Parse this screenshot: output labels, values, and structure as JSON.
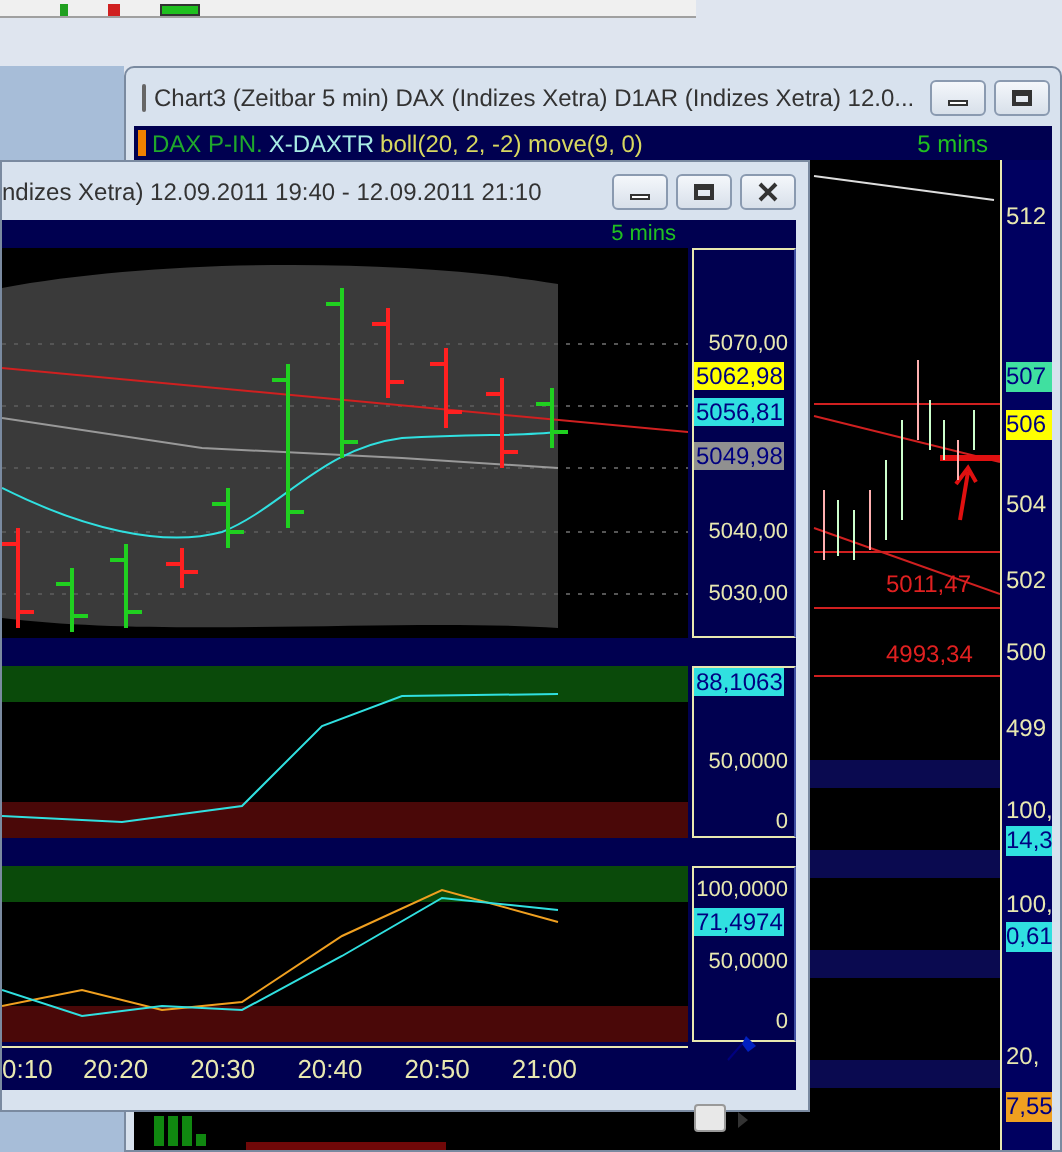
{
  "back_window": {
    "title": "Chart3 (Zeitbar 5 min)  DAX (Indizes Xetra) D1AR (Indizes Xetra) 12.0...",
    "legend": [
      "DAX P-IN.",
      "X-DAXTR",
      "boll(20, 2, -2) move(9, 0)"
    ],
    "interval": "5 mins",
    "line_labels": [
      "5011,47",
      "4993,34"
    ],
    "axis_labels": [
      {
        "text": "512"
      },
      {
        "text": "507",
        "color": "#40e0a0"
      },
      {
        "text": "506",
        "color": "#ffff00"
      },
      {
        "text": "504"
      },
      {
        "text": "502"
      },
      {
        "text": "500"
      },
      {
        "text": "499"
      },
      {
        "text": "100,"
      },
      {
        "text": "14,3",
        "color": "#30e0e0"
      },
      {
        "text": "100,"
      },
      {
        "text": "0,61",
        "color": "#30e0e0"
      },
      {
        "text": "20,"
      },
      {
        "text": "7,55",
        "color": "#f0a020"
      }
    ]
  },
  "front_window": {
    "title": "ndizes Xetra) 12.09.2011 19:40 - 12.09.2011 21:10",
    "interval": "5 mins",
    "panes": [
      {
        "ticks": [
          "5070,00",
          "5040,00",
          "5030,00"
        ],
        "badges": [
          {
            "text": "5062,98",
            "color": "#ffff00"
          },
          {
            "text": "5056,81",
            "color": "#30e0e0"
          },
          {
            "text": "5049,98",
            "color": "#909090"
          }
        ]
      },
      {
        "ticks": [
          "50,0000",
          "0"
        ],
        "badges": [
          {
            "text": "88,1063",
            "color": "#30e0e0"
          }
        ]
      },
      {
        "ticks": [
          "100,0000",
          "50,0000",
          "0"
        ],
        "badges": [
          {
            "text": "71,4974",
            "color": "#30e0e0"
          }
        ]
      }
    ],
    "time_labels": [
      "0:10",
      "20:20",
      "20:30",
      "20:40",
      "20:50",
      "21:00"
    ]
  }
}
